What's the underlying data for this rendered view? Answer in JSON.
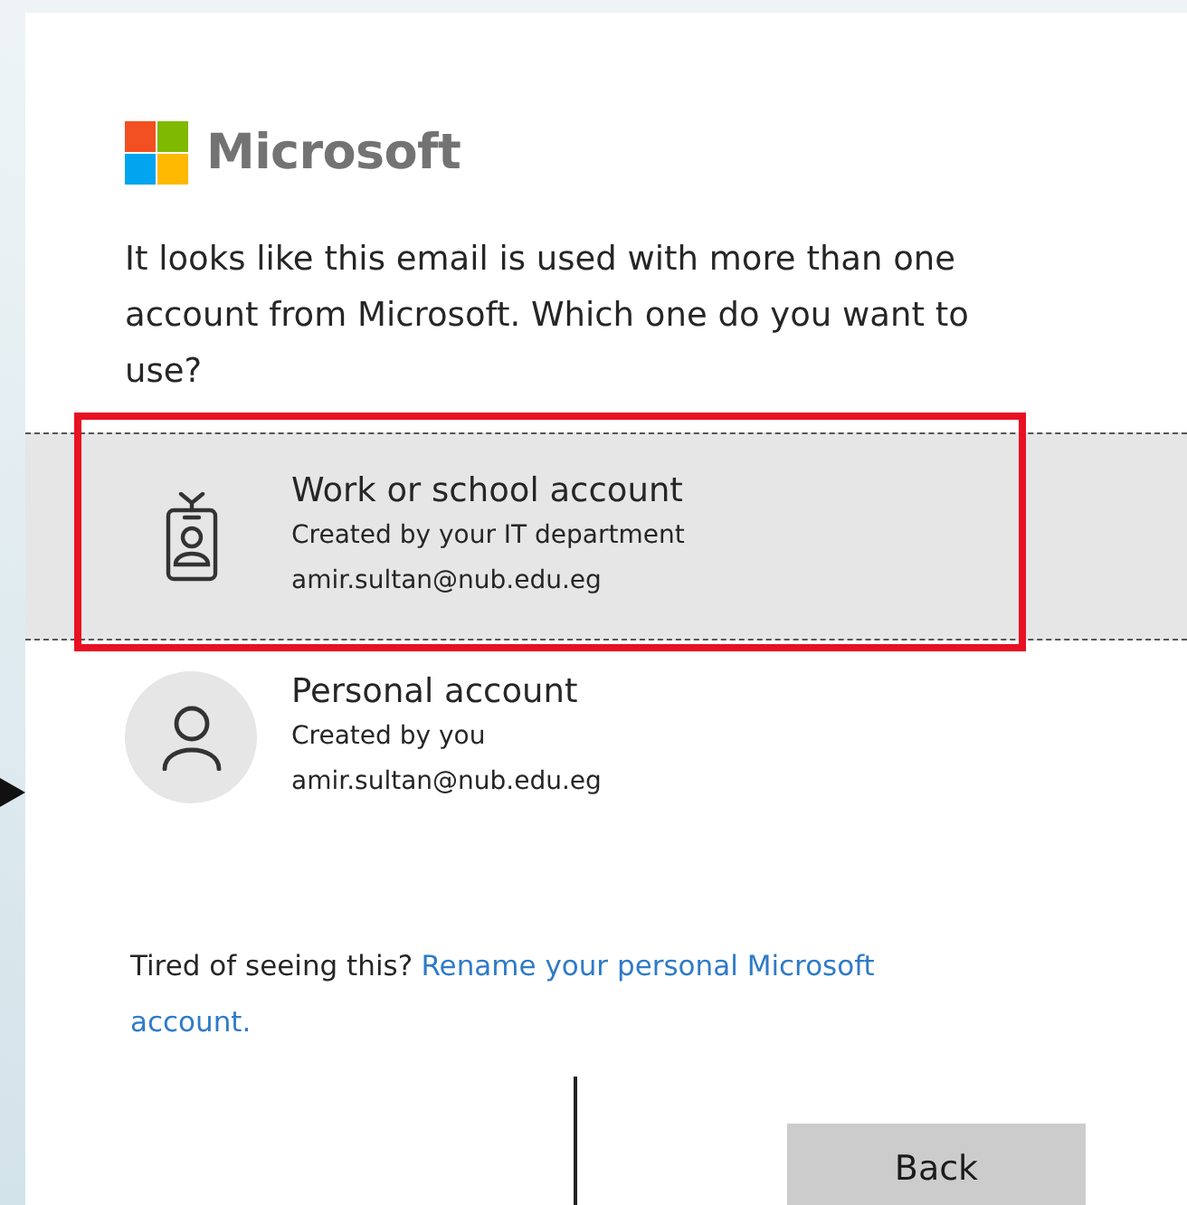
{
  "brand": {
    "name": "Microsoft"
  },
  "prompt": "It looks like this email is used with more than one account from Microsoft. Which one do you want to use?",
  "accounts": [
    {
      "kind": "work",
      "title": "Work or school account",
      "subtitle": "Created by your IT department",
      "email": "amir.sultan@nub.edu.eg",
      "selected": true,
      "highlighted": true
    },
    {
      "kind": "personal",
      "title": "Personal account",
      "subtitle": "Created by you",
      "email": "amir.sultan@nub.edu.eg",
      "selected": false,
      "highlighted": false
    }
  ],
  "footer": {
    "text": "Tired of seeing this?",
    "link_lines": [
      "Rename your personal Microsoft",
      "account."
    ]
  },
  "buttons": [
    {
      "label": "Back"
    }
  ]
}
